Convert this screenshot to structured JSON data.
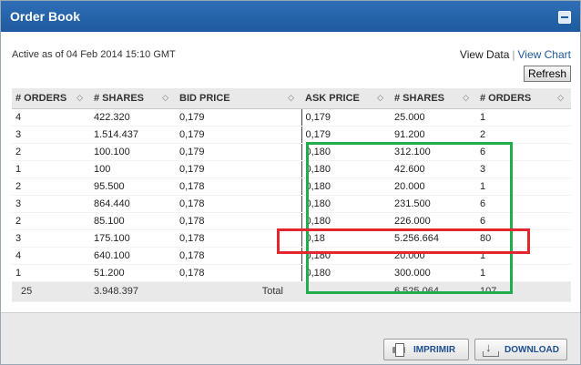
{
  "header": {
    "title": "Order Book",
    "collapse_icon": "minus-icon"
  },
  "status": {
    "active_as_of": "Active as of 04 Feb 2014 15:10 GMT"
  },
  "links": {
    "view_data": "View Data",
    "separator": "|",
    "view_chart": "View Chart"
  },
  "refresh_label": "Refresh",
  "sort_glyph": "◇",
  "table": {
    "columns": [
      "# ORDERS",
      "# SHARES",
      "BID PRICE",
      "ASK PRICE",
      "# SHARES",
      "# ORDERS"
    ],
    "rows": [
      [
        "4",
        "422.320",
        "0,179",
        "0,179",
        "25.000",
        "1"
      ],
      [
        "3",
        "1.514.437",
        "0,179",
        "0,179",
        "91.200",
        "2"
      ],
      [
        "2",
        "100.100",
        "0,179",
        "0,180",
        "312.100",
        "6"
      ],
      [
        "1",
        "100",
        "0,179",
        "0,180",
        "42.600",
        "3"
      ],
      [
        "2",
        "95.500",
        "0,178",
        "0,180",
        "20.000",
        "1"
      ],
      [
        "3",
        "864.440",
        "0,178",
        "0,180",
        "231.500",
        "6"
      ],
      [
        "2",
        "85.100",
        "0,178",
        "0,180",
        "226.000",
        "6"
      ],
      [
        "3",
        "175.100",
        "0,178",
        "0,18",
        "5.256.664",
        "80"
      ],
      [
        "4",
        "640.100",
        "0,178",
        "0,180",
        "20.000",
        "1"
      ],
      [
        "1",
        "51.200",
        "0,178",
        "0,180",
        "300.000",
        "1"
      ]
    ],
    "totals": {
      "bid_orders": "25",
      "bid_shares": "3.948.397",
      "label": "Total",
      "ask_shares": "6.525.064",
      "ask_orders": "107"
    }
  },
  "annotations": {
    "green_color": "#1fae4b",
    "red_color": "#e3262f"
  },
  "footer": {
    "print_label": "IMPRIMIR",
    "print_icon": "printer-icon",
    "download_label": "DOWNLOAD",
    "download_icon": "download-icon"
  }
}
